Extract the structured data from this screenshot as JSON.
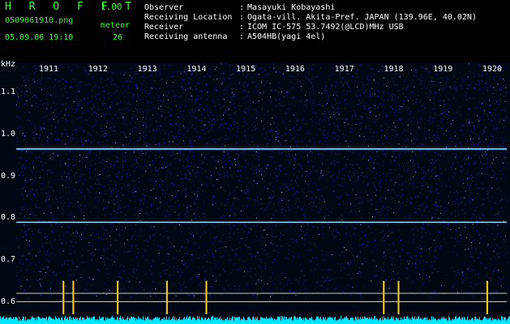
{
  "app": {
    "title": "H R O F F T",
    "version": "1.00",
    "filename": "0509061910.png",
    "timestamp": "05.09.06 19:10",
    "meteor_label": "meteor",
    "meteor_count": "26"
  },
  "info": [
    {
      "label": "Observer",
      "sep": ":",
      "value": "Masayuki Kobayashi"
    },
    {
      "label": "Receiving Location",
      "sep": ":",
      "value": "Ogata-vill. Akita-Pref. JAPAN (139.96E, 40.02N)"
    },
    {
      "label": "Receiver",
      "sep": ":",
      "value": "ICOM IC-575 53.7492(@LCD)MHz USB"
    },
    {
      "label": "Receiving antenna",
      "sep": ":",
      "value": "A504HB(yagi 4el)"
    }
  ],
  "chart_data": {
    "type": "heatmap",
    "ylabel": "kHz",
    "y_ticks": [
      "1.1",
      "1.0",
      "0.9",
      "0.8",
      "0.7",
      "0.6"
    ],
    "x_ticks": [
      "1911",
      "1912",
      "1913",
      "1914",
      "1915",
      "1916",
      "1917",
      "1918",
      "1919",
      "1920"
    ],
    "ylim": [
      0.57,
      1.17
    ],
    "carrier_lines_khz": [
      0.965,
      0.79
    ],
    "reference_lines_khz": [
      0.62,
      0.6
    ],
    "meteor_echo_minutes": [
      1911.3,
      1911.5,
      1912.4,
      1913.4,
      1914.2,
      1917.8,
      1918.1,
      1919.9
    ],
    "colors": {
      "background": "#000814",
      "noise": "#1b2fc8",
      "carrier": "#55c8ff",
      "echo": "#ffd21a",
      "noise_floor": "#00e6ff"
    }
  }
}
